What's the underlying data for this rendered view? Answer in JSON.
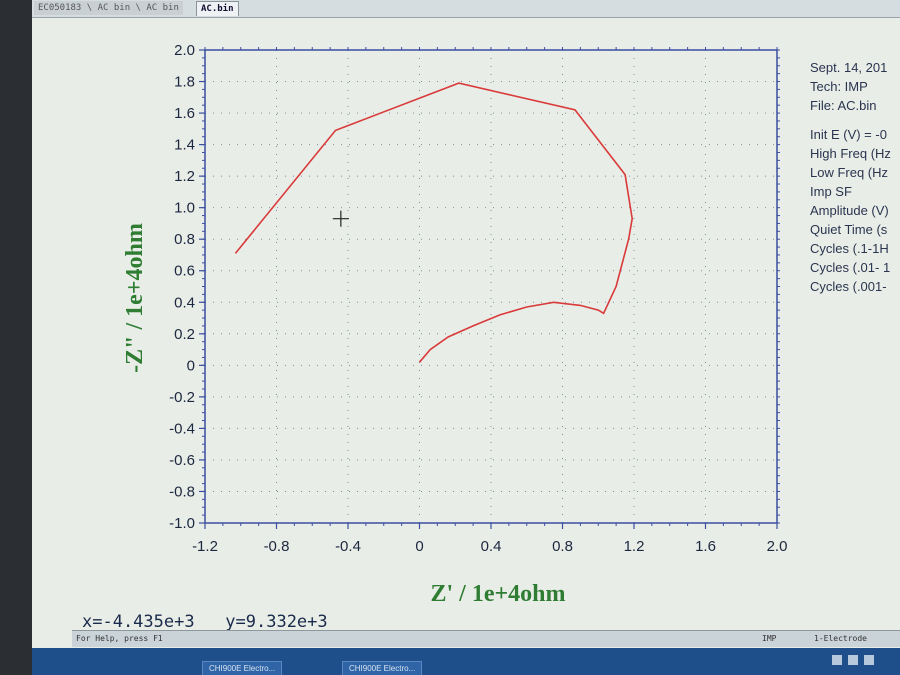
{
  "tabs": [
    {
      "label": "EC050183 \\ AC bin \\ AC bin"
    },
    {
      "label": "AC.bin"
    }
  ],
  "chart_data": {
    "type": "line",
    "title": "",
    "xlabel": "Z' / 1e+4ohm",
    "ylabel": "-Z\" / 1e+4ohm",
    "xlim": [
      -1.2,
      2.0
    ],
    "ylim": [
      -1.0,
      2.0
    ],
    "grid": true,
    "x_ticks": [
      -1.2,
      -0.8,
      -0.4,
      0,
      0.4,
      0.8,
      1.2,
      1.6,
      2.0
    ],
    "x_tick_labels": [
      "-1.2",
      "-0.8",
      "-0.4",
      "0",
      "0.4",
      "0.8",
      "1.2",
      "1.6",
      "2.0"
    ],
    "y_ticks": [
      2.0,
      1.8,
      1.6,
      1.4,
      1.2,
      1.0,
      0.8,
      0.6,
      0.4,
      0.2,
      0,
      -0.2,
      -0.4,
      -0.6,
      -0.8,
      -1.0
    ],
    "y_tick_labels": [
      "2.0",
      "1.8",
      "1.6",
      "1.4",
      "1.2",
      "1.0",
      "0.8",
      "0.6",
      "0.4",
      "0.2",
      "0",
      "-0.2",
      "-0.4",
      "-0.6",
      "-0.8",
      "-1.0"
    ],
    "series": [
      {
        "color": "#d93a3a",
        "x": [
          0.0,
          0.06,
          0.16,
          0.3,
          0.45,
          0.6,
          0.75,
          0.9,
          1.0,
          1.03,
          1.1,
          1.17,
          1.19,
          1.15,
          0.87,
          0.22,
          -0.47,
          -1.03
        ],
        "y": [
          0.02,
          0.1,
          0.18,
          0.25,
          0.32,
          0.37,
          0.4,
          0.38,
          0.35,
          0.33,
          0.5,
          0.8,
          0.93,
          1.21,
          1.62,
          1.79,
          1.49,
          0.71
        ]
      }
    ],
    "cursor_marker": {
      "x": -0.44,
      "y": 0.93
    }
  },
  "info": {
    "date": "Sept. 14, 201",
    "tech": "Tech: IMP",
    "file": "File: AC.bin",
    "params": [
      "Init E (V) = -0",
      "High Freq (Hz",
      "Low Freq (Hz",
      "Imp SF",
      "Amplitude (V)",
      "Quiet Time (s",
      "Cycles (.1-1H",
      "Cycles (.01- 1",
      "Cycles (.001-"
    ]
  },
  "coord_readout": "x=-4.435e+3   y=9.332e+3",
  "statusbar": {
    "help": "For Help, press F1",
    "mode": "IMP",
    "electrode": "1-Electrode"
  },
  "taskbar": {
    "items": [
      "CHI900E Electro...",
      "CHI900E Electro..."
    ]
  },
  "colors": {
    "axis": "#3b4fa0",
    "grid": "#7f8ca0",
    "curve": "#d93a3a",
    "axis_title": "#2e7d32"
  }
}
